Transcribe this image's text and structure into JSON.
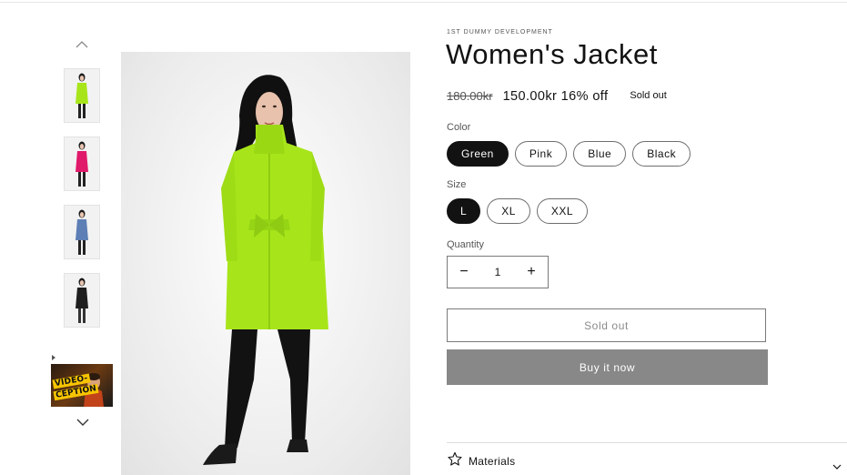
{
  "product": {
    "vendor": "1ST DUMMY DEVELOPMENT",
    "title": "Women's Jacket",
    "compare_price": "180.00kr",
    "price": "150.00kr",
    "discount": "16% off",
    "badge": "Sold out"
  },
  "color": {
    "label": "Color",
    "options": [
      "Green",
      "Pink",
      "Blue",
      "Black"
    ],
    "selected": "Green"
  },
  "size": {
    "label": "Size",
    "options": [
      "L",
      "XL",
      "XXL"
    ],
    "selected": "L"
  },
  "quantity": {
    "label": "Quantity",
    "value": "1",
    "minus": "−",
    "plus": "+"
  },
  "buttons": {
    "add_to_cart": "Sold out",
    "buy_now": "Buy it now"
  },
  "accordion": {
    "materials": "Materials"
  },
  "gallery": {
    "thumb_colors": [
      "#a7e51a",
      "#e0196a",
      "#5d7fb5",
      "#1e1e1e"
    ],
    "video_text_line1": "VIDEO-",
    "video_text_line2": "CEPTION",
    "icons": [
      "chevron-up-icon",
      "chevron-down-icon",
      "play-icon"
    ]
  },
  "colors": {
    "ink": "#121212",
    "buy_button": "#888888",
    "coat_green": "#a7e51a"
  }
}
